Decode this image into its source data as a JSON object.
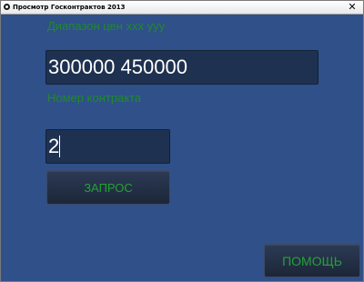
{
  "window": {
    "title": "Просмотр Госконтрактов 2013",
    "close_glyph": "✕"
  },
  "form": {
    "range_label": "Диапазон цен xxx yyy",
    "range_value": "300000 450000",
    "contract_label": "Номер контракта",
    "contract_value": "2",
    "query_button": "ЗАПРОС",
    "help_button": "ПОМОЩЬ"
  },
  "colors": {
    "background": "#2f5088",
    "field": "#1f3150",
    "label_text": "#1f8a2c",
    "button_text": "#21a335"
  }
}
